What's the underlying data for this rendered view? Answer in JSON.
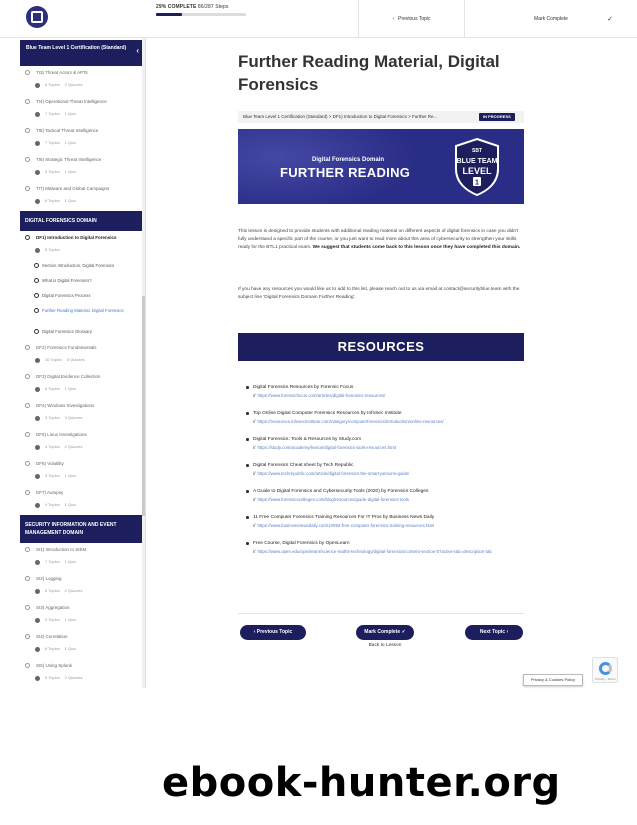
{
  "topbar": {
    "progress_percent_label": "29% COMPLETE",
    "progress_steps": "86/287 Steps",
    "progress_fraction": 0.29,
    "prev_topic": "Previous Topic",
    "mark_complete": "Mark Complete"
  },
  "sidebar": {
    "course_title": "Blue Team Level 1 Certification (Standard)",
    "top_lessons": [
      {
        "label": "TI3) Threat Actors & APTs",
        "topics": "6 Topics",
        "quizzes": "2 Quizzes"
      },
      {
        "label": "TI4) Operational Threat Intelligence",
        "topics": "7 Topics",
        "quizzes": "1 Quiz"
      },
      {
        "label": "TI5) Tactical Threat Intelligence",
        "topics": "7 Topics",
        "quizzes": "1 Quiz"
      },
      {
        "label": "TI6) Strategic Threat Intelligence",
        "topics": "5 Topics",
        "quizzes": "1 Quiz"
      },
      {
        "label": "TI7) Malware and Global Campaigns",
        "topics": "6 Topics",
        "quizzes": "1 Quiz"
      }
    ],
    "domain1": "DIGITAL FORENSICS DOMAIN",
    "df1": {
      "label": "DF1) Introduction to Digital Forensics",
      "topics": "5 Topics"
    },
    "df1_topics": [
      "Section Introduction, Digital Forensics",
      "What is Digital Forensics?",
      "Digital Forensics Process",
      "Further Reading Material, Digital Forensics",
      "Digital Forensics Glossary"
    ],
    "df_lessons": [
      {
        "label": "DF2) Forensics Fundamentals",
        "topics": "10 Topics",
        "quizzes": "5 Quizzes"
      },
      {
        "label": "DF3) Digital Evidence Collection",
        "topics": "8 Topics",
        "quizzes": "1 Quiz"
      },
      {
        "label": "DF4) Windows Investigations",
        "topics": "3 Topics",
        "quizzes": "3 Quizzes"
      },
      {
        "label": "DF5) Linux Investigations",
        "topics": "4 Topics",
        "quizzes": "2 Quizzes"
      },
      {
        "label": "DF6) Volatility",
        "topics": "3 Topics",
        "quizzes": "1 Quiz"
      },
      {
        "label": "DF7) Autopsy",
        "topics": "4 Topics",
        "quizzes": "1 Quiz"
      }
    ],
    "domain2": "SECURITY INFORMATION AND EVENT MANAGEMENT DOMAIN",
    "siem_lessons": [
      {
        "label": "SI1) Introduction to SIEM",
        "topics": "7 Topics",
        "quizzes": "1 Quiz"
      },
      {
        "label": "SI2) Logging",
        "topics": "6 Topics",
        "quizzes": "2 Quizzes"
      },
      {
        "label": "SI3) Aggregation",
        "topics": "2 Topics",
        "quizzes": "1 Quiz"
      },
      {
        "label": "SI4) Correlation",
        "topics": "6 Topics",
        "quizzes": "1 Quiz"
      },
      {
        "label": "SI5) Using Splunk",
        "topics": "5 Topics",
        "quizzes": "2 Quizzes"
      }
    ]
  },
  "main": {
    "title": "Further Reading Material, Digital Forensics",
    "breadcrumb": "Blue Team Level 1 Certification (Standard) > DF1) Introduction to Digital Forensics > Further Re...",
    "status_badge": "IN PROGRESS",
    "banner": {
      "subtitle": "Digital Forensics Domain",
      "title": "FURTHER READING",
      "shield_sbt": "SBT",
      "shield_line1": "BLUE TEAM",
      "shield_line2": "LEVEL",
      "shield_num": "1"
    },
    "para1_a": "This lesson is designed to provide students with additional reading material on different aspects of digital forensics in case you didn't fully understand a specific part of the course, or you just want to read more about this area of cybersecurity to strengthen your skills ready for the BTL1 practical exam. ",
    "para1_b": "We suggest that students come back to this lesson once they have completed this domain.",
    "para2": "If you have any resources you would like us to add to this list, please reach out to us via email at contact@securityblue.team with the subject line 'Digital Forensics Domain Further Reading'.",
    "resources_heading": "RESOURCES",
    "resources": [
      {
        "title": "Digital Forensics Resources by Forensic Focus",
        "url": "https://www.forensicfocus.com/articles/digital-forensics-resources/"
      },
      {
        "title": "Top Online Digital Computer Forensics Resources by InfoSec Institute",
        "url": "https://resources.infosecinstitute.com/category/computerforensics/introduction/online-resources/"
      },
      {
        "title": "Digital Forensics: Tools & Resources by Study.com",
        "url": "https://study.com/academy/lesson/digital-forensics-tools-resources.html"
      },
      {
        "title": "Digital Forensics Cheat sheet by Tech Republic",
        "url": "https://www.techrepublic.com/article/digital-forensics-the-smart-persons-guide/"
      },
      {
        "title": "A Guide to Digital Forensics and Cybersecurity Tools (2020) by Forensics Colleges",
        "url": "https://www.forensicscolleges.com/blog/resources/guide-digital-forensics-tools"
      },
      {
        "title": "11 Free Computer Forensics Training Resources For IT Pros by Business News Daily",
        "url": "https://www.businessnewsdaily.com/10093-free-computer-forensics-training-resources.html"
      },
      {
        "title": "Free Course, Digital Forensics by OpenLearn",
        "url": "https://www.open.edu/openlearn/science-maths-technology/digital-forensics/content-section-0?active-tab=description-tab"
      }
    ],
    "prev_topic": "Previous Topic",
    "mark_complete": "Mark Complete",
    "next_topic": "Next Topic",
    "back_to_lesson": "Back to Lesson"
  },
  "recaptcha": {
    "text": "Privacy - Terms"
  },
  "privacy_button": "Privacy & Cookies Policy",
  "watermark": "ebook-hunter.org",
  "colors": {
    "navy": "#1c1e5e",
    "banner": "#2a2d86",
    "link": "#5a7fc4"
  }
}
